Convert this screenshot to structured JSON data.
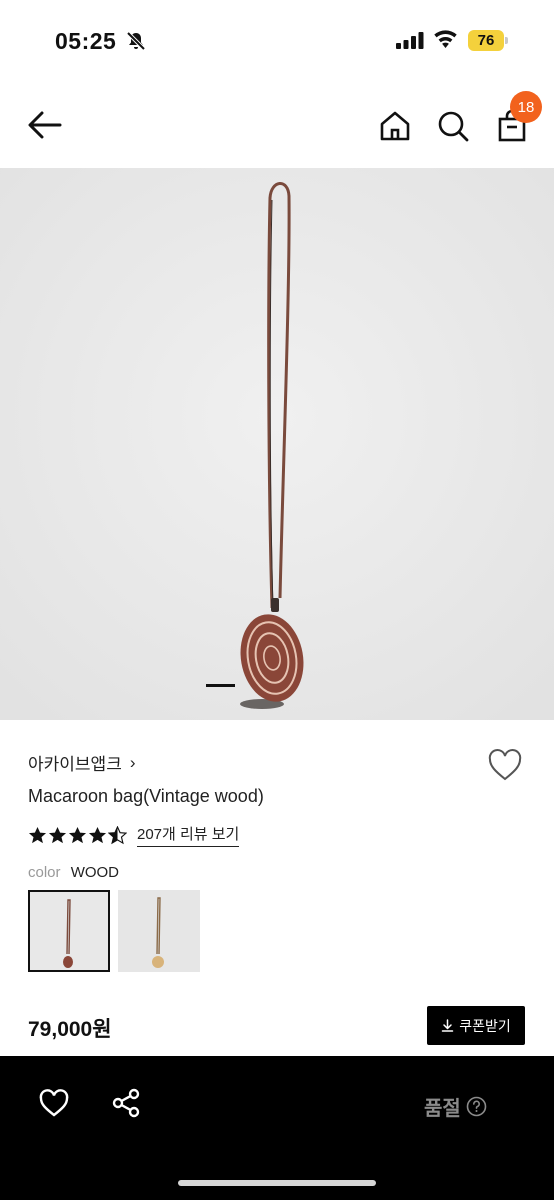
{
  "status_bar": {
    "time": "05:25",
    "battery_level": "76",
    "icons": [
      "bell-slash-icon",
      "signal-icon",
      "wifi-icon",
      "battery-icon"
    ]
  },
  "header": {
    "icons": [
      "back-arrow-icon",
      "home-icon",
      "search-icon",
      "shopping-bag-icon"
    ],
    "cart_count": "18",
    "badge_color": "#f2621d"
  },
  "product": {
    "brand": "아카이브앱크",
    "brand_chevron": "›",
    "name": "Macaroon bag(Vintage wood)",
    "rating": 4.5,
    "review_link": "207개 리뷰 보기",
    "color_label": "color",
    "color_value": "WOOD",
    "price": "79,000원",
    "coupon_label": "쿠폰받기",
    "carousel_active_index": 1
  },
  "bottom_bar": {
    "status": "품절",
    "icons": [
      "heart-icon",
      "share-icon",
      "help-icon"
    ]
  }
}
